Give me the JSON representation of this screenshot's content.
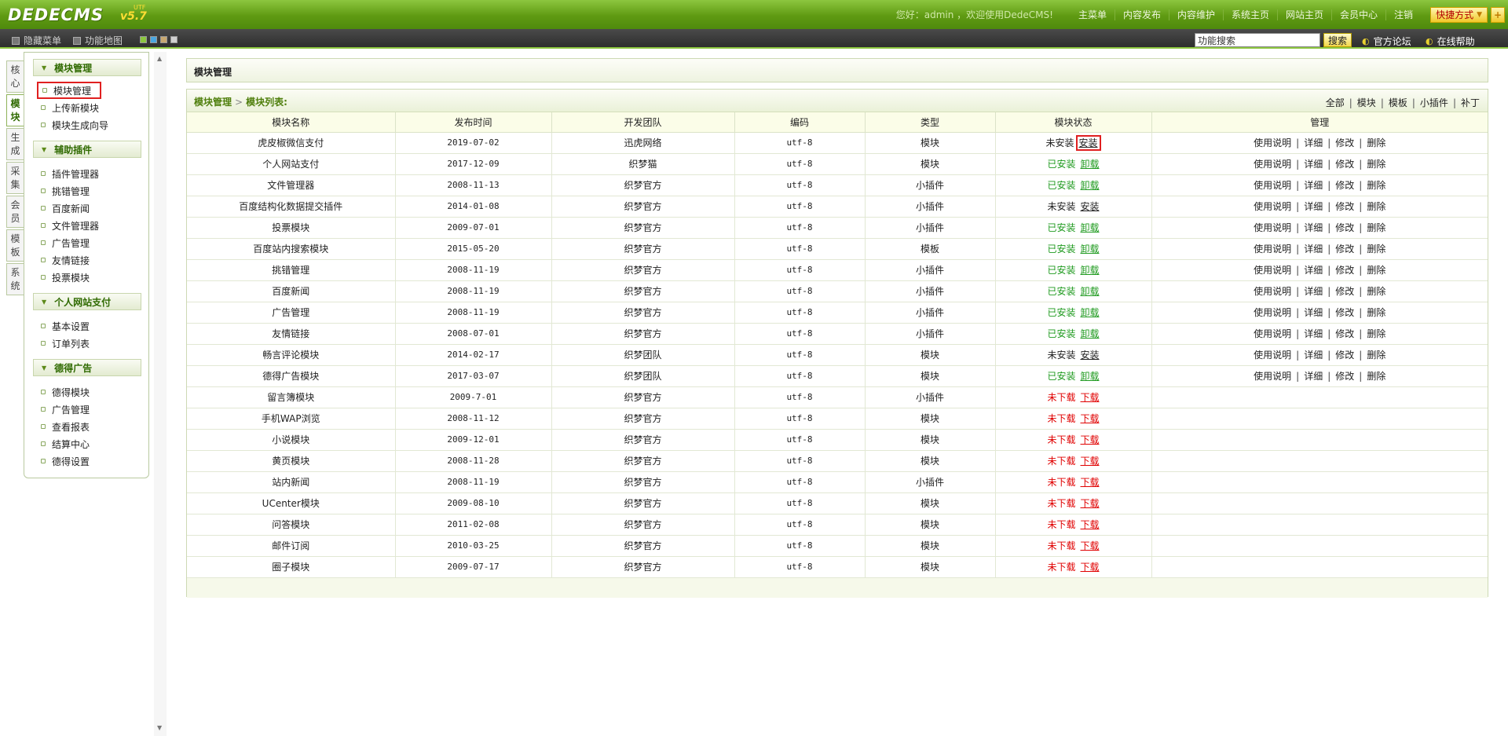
{
  "header": {
    "logo": "DEDECMS",
    "version": "v5.7",
    "version_sup": "UTF",
    "welcome": "您好：admin ，欢迎使用DedeCMS!",
    "nav": [
      "主菜单",
      "内容发布",
      "内容维护",
      "系统主页",
      "网站主页",
      "会员中心",
      "注销"
    ],
    "quick_label": "快捷方式",
    "quick_plus": "+"
  },
  "subbar": {
    "hide_menu": "隐藏菜单",
    "func_map": "功能地图",
    "search_placeholder": "功能搜索",
    "search_button": "搜索",
    "forum": "官方论坛",
    "help": "在线帮助",
    "swatch_colors": [
      "#8cc63f",
      "#4aa6e0",
      "#c8a870",
      "#d0d0d0"
    ]
  },
  "vtabs": [
    {
      "label": "核心",
      "active": false
    },
    {
      "label": "模块",
      "active": true
    },
    {
      "label": "生成",
      "active": false
    },
    {
      "label": "采集",
      "active": false
    },
    {
      "label": "会员",
      "active": false
    },
    {
      "label": "模板",
      "active": false
    },
    {
      "label": "系统",
      "active": false
    }
  ],
  "menu": {
    "groups": [
      {
        "title": "模块管理",
        "items": [
          "模块管理",
          "上传新模块",
          "模块生成向导"
        ]
      },
      {
        "title": "辅助插件",
        "items": [
          "插件管理器",
          "挑错管理",
          "百度新闻",
          "文件管理器",
          "广告管理",
          "友情链接",
          "投票模块"
        ]
      },
      {
        "title": "个人网站支付",
        "items": [
          "基本设置",
          "订单列表"
        ]
      },
      {
        "title": "德得广告",
        "items": [
          "德得模块",
          "广告管理",
          "查看报表",
          "结算中心",
          "德得设置"
        ]
      }
    ]
  },
  "main": {
    "title": "模块管理",
    "breadcrumb": [
      "模块管理",
      "模块列表:"
    ],
    "filters": [
      "全部",
      "模块",
      "模板",
      "小插件",
      "补丁"
    ],
    "columns": [
      "模块名称",
      "发布时间",
      "开发团队",
      "编码",
      "类型",
      "模块状态",
      "管理"
    ],
    "manage_actions": [
      "使用说明",
      "详细",
      "修改",
      "删除"
    ],
    "rows": [
      {
        "name": "虎皮椒微信支付",
        "date": "2019-07-02",
        "team": "迅虎网络",
        "enc": "utf-8",
        "type": "模块",
        "status": "未安装",
        "action": "安装",
        "kind": "notinstalled",
        "manage": true
      },
      {
        "name": "个人网站支付",
        "date": "2017-12-09",
        "team": "织梦猫",
        "enc": "utf-8",
        "type": "模块",
        "status": "已安装",
        "action": "卸载",
        "kind": "installed",
        "manage": true
      },
      {
        "name": "文件管理器",
        "date": "2008-11-13",
        "team": "织梦官方",
        "enc": "utf-8",
        "type": "小插件",
        "status": "已安装",
        "action": "卸载",
        "kind": "installed",
        "manage": true
      },
      {
        "name": "百度结构化数据提交插件",
        "date": "2014-01-08",
        "team": "织梦官方",
        "enc": "utf-8",
        "type": "小插件",
        "status": "未安装",
        "action": "安装",
        "kind": "notinstalled",
        "manage": true
      },
      {
        "name": "投票模块",
        "date": "2009-07-01",
        "team": "织梦官方",
        "enc": "utf-8",
        "type": "小插件",
        "status": "已安装",
        "action": "卸载",
        "kind": "installed",
        "manage": true
      },
      {
        "name": "百度站内搜索模块",
        "date": "2015-05-20",
        "team": "织梦官方",
        "enc": "utf-8",
        "type": "模板",
        "status": "已安装",
        "action": "卸载",
        "kind": "installed",
        "manage": true
      },
      {
        "name": "挑错管理",
        "date": "2008-11-19",
        "team": "织梦官方",
        "enc": "utf-8",
        "type": "小插件",
        "status": "已安装",
        "action": "卸载",
        "kind": "installed",
        "manage": true
      },
      {
        "name": "百度新闻",
        "date": "2008-11-19",
        "team": "织梦官方",
        "enc": "utf-8",
        "type": "小插件",
        "status": "已安装",
        "action": "卸载",
        "kind": "installed",
        "manage": true
      },
      {
        "name": "广告管理",
        "date": "2008-11-19",
        "team": "织梦官方",
        "enc": "utf-8",
        "type": "小插件",
        "status": "已安装",
        "action": "卸载",
        "kind": "installed",
        "manage": true
      },
      {
        "name": "友情链接",
        "date": "2008-07-01",
        "team": "织梦官方",
        "enc": "utf-8",
        "type": "小插件",
        "status": "已安装",
        "action": "卸载",
        "kind": "installed",
        "manage": true
      },
      {
        "name": "畅言评论模块",
        "date": "2014-02-17",
        "team": "织梦团队",
        "enc": "utf-8",
        "type": "模块",
        "status": "未安装",
        "action": "安装",
        "kind": "notinstalled",
        "manage": true
      },
      {
        "name": "德得广告模块",
        "date": "2017-03-07",
        "team": "织梦团队",
        "enc": "utf-8",
        "type": "模块",
        "status": "已安装",
        "action": "卸载",
        "kind": "installed",
        "manage": true
      },
      {
        "name": "留言簿模块",
        "date": "2009-7-01",
        "team": "织梦官方",
        "enc": "utf-8",
        "type": "小插件",
        "status": "未下载",
        "action": "下载",
        "kind": "notdl",
        "manage": false
      },
      {
        "name": "手机WAP浏览",
        "date": "2008-11-12",
        "team": "织梦官方",
        "enc": "utf-8",
        "type": "模块",
        "status": "未下载",
        "action": "下载",
        "kind": "notdl",
        "manage": false
      },
      {
        "name": "小说模块",
        "date": "2009-12-01",
        "team": "织梦官方",
        "enc": "utf-8",
        "type": "模块",
        "status": "未下载",
        "action": "下载",
        "kind": "notdl",
        "manage": false
      },
      {
        "name": "黄页模块",
        "date": "2008-11-28",
        "team": "织梦官方",
        "enc": "utf-8",
        "type": "模块",
        "status": "未下载",
        "action": "下载",
        "kind": "notdl",
        "manage": false
      },
      {
        "name": "站内新闻",
        "date": "2008-11-19",
        "team": "织梦官方",
        "enc": "utf-8",
        "type": "小插件",
        "status": "未下载",
        "action": "下载",
        "kind": "notdl",
        "manage": false
      },
      {
        "name": "UCenter模块",
        "date": "2009-08-10",
        "team": "织梦官方",
        "enc": "utf-8",
        "type": "模块",
        "status": "未下载",
        "action": "下载",
        "kind": "notdl",
        "manage": false
      },
      {
        "name": "问答模块",
        "date": "2011-02-08",
        "team": "织梦官方",
        "enc": "utf-8",
        "type": "模块",
        "status": "未下载",
        "action": "下载",
        "kind": "notdl",
        "manage": false
      },
      {
        "name": "邮件订阅",
        "date": "2010-03-25",
        "team": "织梦官方",
        "enc": "utf-8",
        "type": "模块",
        "status": "未下载",
        "action": "下载",
        "kind": "notdl",
        "manage": false
      },
      {
        "name": "圈子模块",
        "date": "2009-07-17",
        "team": "织梦官方",
        "enc": "utf-8",
        "type": "模块",
        "status": "未下载",
        "action": "下载",
        "kind": "notdl",
        "manage": false
      }
    ]
  }
}
